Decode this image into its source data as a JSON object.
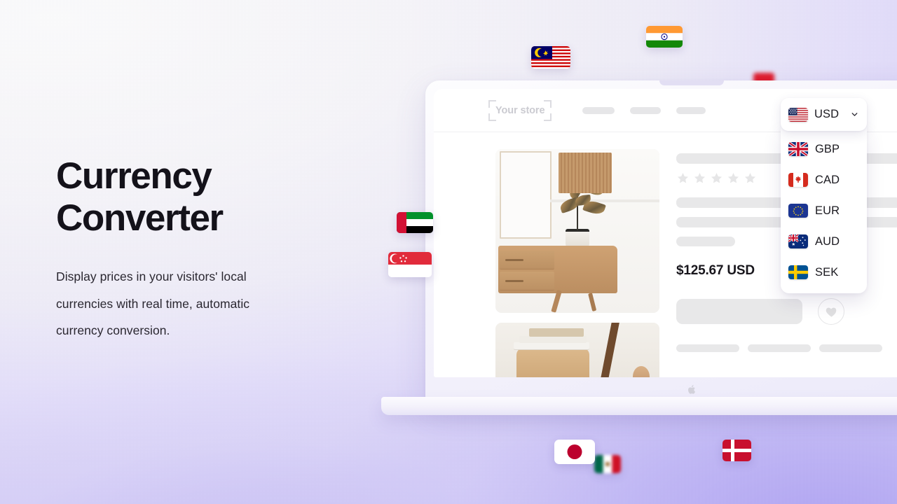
{
  "page": {
    "background_start": "#fbfbfc",
    "background_end": "#b0a4f3"
  },
  "hero": {
    "headline": "Currency\nConverter",
    "subcopy": "Display prices in your visitors' local currencies with real time, automatic currency conversion.",
    "headline_color": "#14121a"
  },
  "device": {
    "brand_icon": "apple-logo-icon"
  },
  "store": {
    "logo_placeholder": "Your store",
    "nav_placeholders": 3
  },
  "product": {
    "price": "$125.67 USD",
    "rating_stars": 5,
    "rating_filled": 0,
    "favorite_icon": "heart-icon",
    "gallery": [
      {
        "alt_name": "product-image-sideboard-plant"
      },
      {
        "alt_name": "product-image-books-stool"
      }
    ],
    "placeholder_chips": 3
  },
  "currency_widget": {
    "selected": {
      "code": "USD",
      "flag": "flag-us"
    },
    "chevron_icon": "chevron-down-icon",
    "options": [
      {
        "code": "GBP",
        "flag": "flag-gb"
      },
      {
        "code": "CAD",
        "flag": "flag-ca"
      },
      {
        "code": "EUR",
        "flag": "flag-eu"
      },
      {
        "code": "AUD",
        "flag": "flag-au"
      },
      {
        "code": "SEK",
        "flag": "flag-se"
      }
    ]
  },
  "floating_flags": [
    {
      "name": "flag-malaysia"
    },
    {
      "name": "flag-india"
    },
    {
      "name": "flag-uae"
    },
    {
      "name": "flag-singapore"
    },
    {
      "name": "flag-japan"
    },
    {
      "name": "flag-mexico"
    },
    {
      "name": "flag-denmark"
    },
    {
      "name": "flag-partial-red"
    }
  ]
}
